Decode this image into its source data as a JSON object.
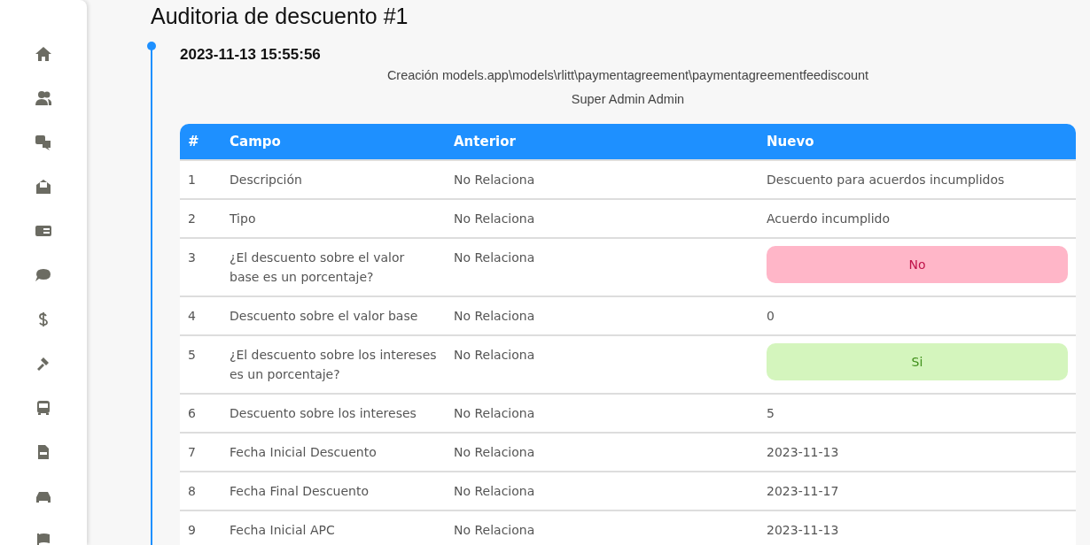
{
  "title": "Auditoria de descuento #1",
  "entry": {
    "timestamp": "2023-11-13 15:55:56",
    "action": "Creación models.app\\models\\rlitt\\paymentagreement\\paymentagreementfeediscount",
    "user": "Super Admin Admin"
  },
  "table": {
    "columns": [
      "#",
      "Campo",
      "Anterior",
      "Nuevo"
    ],
    "rows": [
      {
        "n": "1",
        "field": "Descripción",
        "previous": "No Relaciona",
        "new": "Descuento para acuerdos incumplidos",
        "kind": "text"
      },
      {
        "n": "2",
        "field": "Tipo",
        "previous": "No Relaciona",
        "new": "Acuerdo incumplido",
        "kind": "text"
      },
      {
        "n": "3",
        "field": "¿El descuento sobre el valor base es un porcentaje?",
        "previous": "No Relaciona",
        "new": "No",
        "kind": "badge",
        "color": "#ffb6c8"
      },
      {
        "n": "4",
        "field": "Descuento sobre el valor base",
        "previous": "No Relaciona",
        "new": "0",
        "kind": "text"
      },
      {
        "n": "5",
        "field": "¿El descuento sobre los intereses es un porcentaje?",
        "previous": "No Relaciona",
        "new": "Si",
        "kind": "badge",
        "color": "#d4f5bd"
      },
      {
        "n": "6",
        "field": "Descuento sobre los intereses",
        "previous": "No Relaciona",
        "new": "5",
        "kind": "text"
      },
      {
        "n": "7",
        "field": "Fecha Inicial Descuento",
        "previous": "No Relaciona",
        "new": "2023-11-13",
        "kind": "text"
      },
      {
        "n": "8",
        "field": "Fecha Final Descuento",
        "previous": "No Relaciona",
        "new": "2023-11-17",
        "kind": "text"
      },
      {
        "n": "9",
        "field": "Fecha Inicial APC",
        "previous": "No Relaciona",
        "new": "2023-11-13",
        "kind": "text"
      }
    ]
  }
}
